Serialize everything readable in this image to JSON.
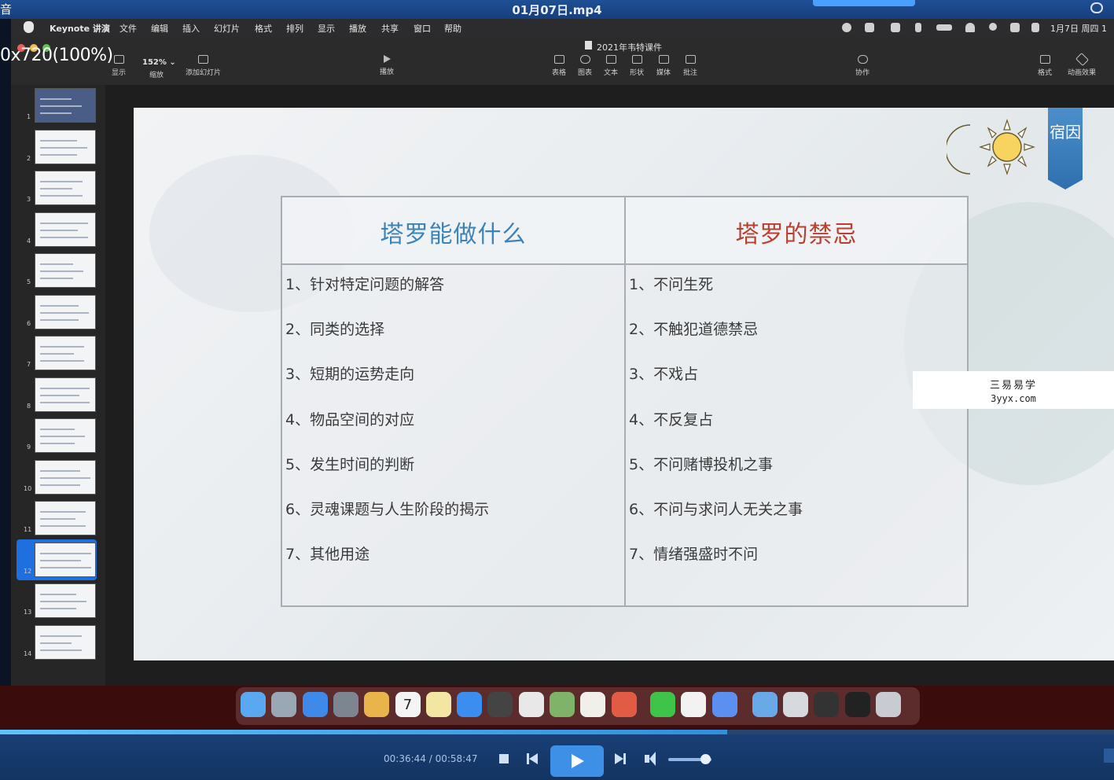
{
  "player": {
    "cut_label": "音",
    "video_title": "01月07日.mp4",
    "time_display": "00:36:44 / 00:58:47",
    "progress_fraction": 0.653,
    "volume_fraction": 0.85
  },
  "menubar": {
    "items": [
      "Keynote 讲演",
      "文件",
      "编辑",
      "插入",
      "幻灯片",
      "格式",
      "排列",
      "显示",
      "播放",
      "共享",
      "窗口",
      "帮助"
    ],
    "clock": "1月7日 周四 1"
  },
  "toolbar": {
    "document_title": "2021年韦特课件",
    "zoom_overlay": "0x720(100%)",
    "zoom_value": "152% ⌄",
    "tools": [
      {
        "label": "显示"
      },
      {
        "label": "缩放"
      },
      {
        "label": "添加幻灯片"
      },
      {
        "label": "播放"
      },
      {
        "label": "表格"
      },
      {
        "label": "图表"
      },
      {
        "label": "文本"
      },
      {
        "label": "形状"
      },
      {
        "label": "媒体"
      },
      {
        "label": "批注"
      },
      {
        "label": "协作"
      },
      {
        "label": "格式"
      },
      {
        "label": "动画效果"
      }
    ]
  },
  "navigator": {
    "slide_numbers": [
      "1",
      "2",
      "3",
      "4",
      "5",
      "6",
      "7",
      "8",
      "9",
      "10",
      "11",
      "12",
      "13",
      "14"
    ],
    "selected_slide": "12"
  },
  "slide": {
    "ribbon_text": "宿因",
    "table": {
      "left_header": "塔罗能做什么",
      "right_header": "塔罗的禁忌",
      "left_items": [
        "1、针对特定问题的解答",
        "2、同类的选择",
        "3、短期的运势走向",
        "4、物品空间的对应",
        "5、发生时间的判断",
        "6、灵魂课题与人生阶段的揭示",
        "7、其他用途"
      ],
      "right_items": [
        "1、不问生死",
        "2、不触犯道德禁忌",
        "3、不戏占",
        "4、不反复占",
        "5、不问赌博投机之事",
        "6、不问与求问人无关之事",
        "7、情绪强盛时不问"
      ]
    }
  },
  "watermark": {
    "line1": "三易易学",
    "line2": "3yyx.com"
  },
  "dock": {
    "icons": [
      "finder-icon",
      "launchpad-icon",
      "safari-icon",
      "system-preferences-icon",
      "photos-icon",
      "calendar-icon",
      "notes-icon",
      "app-store-icon",
      "keynote-icon",
      "preview-icon",
      "maps-icon",
      "textedit-icon",
      "chrome-icon",
      "wechat-icon",
      "wps-icon",
      "feishu-icon",
      "folder-icon",
      "document-icon",
      "phone-icon",
      "screen-icon",
      "trash-icon"
    ],
    "calendar_day": "7"
  },
  "colors": {
    "left_header": "#3d83b7",
    "right_header": "#b7402f",
    "ribbon": "#3a7fbd",
    "selection": "#1f6fe0"
  }
}
